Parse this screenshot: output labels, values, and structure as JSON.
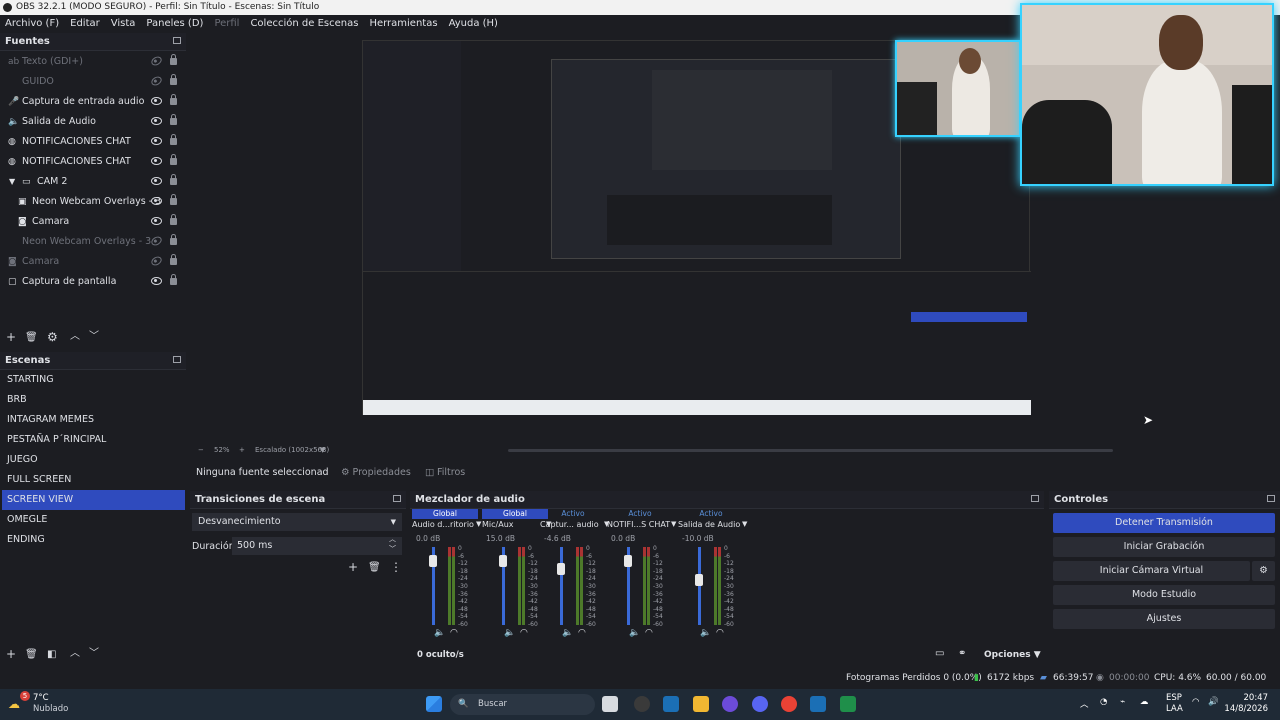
{
  "window": {
    "title": "OBS 32.2.1 (MODO SEGURO) - Perfil: Sin Título - Escenas: Sin Título"
  },
  "menu": [
    "Archivo (F)",
    "Editar",
    "Vista",
    "Paneles (D)",
    "Perfil",
    "Colección de Escenas",
    "Herramientas",
    "Ayuda (H)"
  ],
  "sources": {
    "title": "Fuentes",
    "items": [
      {
        "label": "Texto (GDI+)",
        "icon": "text-icon",
        "visible": false
      },
      {
        "label": "GUIDO",
        "icon": "",
        "visible": false
      },
      {
        "label": "Captura de entrada audio",
        "icon": "microphone-icon",
        "visible": true
      },
      {
        "label": "Salida de Audio",
        "icon": "speaker-icon",
        "visible": true
      },
      {
        "label": "NOTIFICACIONES CHAT",
        "icon": "globe-icon",
        "visible": true
      },
      {
        "label": "NOTIFICACIONES CHAT",
        "icon": "globe-icon",
        "visible": true
      },
      {
        "label": "CAM 2",
        "icon": "folder-icon",
        "visible": true
      },
      {
        "label": "Neon Webcam Overlays - 3",
        "icon": "image-icon",
        "visible": true
      },
      {
        "label": "Camara",
        "icon": "camera-icon",
        "visible": true
      },
      {
        "label": "Neon Webcam Overlays - 3",
        "icon": "",
        "visible": false
      },
      {
        "label": "Camara",
        "icon": "camera-icon",
        "visible": false
      },
      {
        "label": "Captura de pantalla",
        "icon": "monitor-icon",
        "visible": true
      }
    ]
  },
  "scenes": {
    "title": "Escenas",
    "items": [
      "STARTING",
      "BRB",
      "INTAGRAM MEMES",
      "PESTAÑA P´RINCIPAL",
      "JUEGO",
      "FULL SCREEN",
      "SCREEN VIEW",
      "OMEGLE",
      "ENDING"
    ],
    "selected": "SCREEN VIEW"
  },
  "preview": {
    "zoom": "52%",
    "scale_label": "Escalado (1002x563)"
  },
  "propbar": {
    "no_source": "Ninguna fuente seleccionad",
    "properties": "Propiedades",
    "filters": "Filtros"
  },
  "transitions": {
    "title": "Transiciones de escena",
    "transition": "Desvanecimiento",
    "duration_label": "Duración",
    "duration": "500 ms"
  },
  "mixer": {
    "title": "Mezclador de audio",
    "hidden": "0 oculto/s",
    "options": "Opciones",
    "channels": [
      {
        "tag": "Global",
        "name": "Audio d...ritorio",
        "db": "0.0 dB",
        "level": 0.82
      },
      {
        "tag": "Global",
        "name": "Mic/Aux",
        "db": "15.0 dB",
        "level": 0.82
      },
      {
        "tag": "Activo",
        "name": "Captur... audio",
        "db": "-4.6 dB",
        "level": 0.72
      },
      {
        "tag": "Activo",
        "name": "NOTIFI...S CHAT",
        "db": "0.0 dB",
        "level": 0.82
      },
      {
        "tag": "Activo",
        "name": "Salida de Audio",
        "db": "-10.0 dB",
        "level": 0.58
      }
    ],
    "scale": [
      "0",
      "-6",
      "-12",
      "-18",
      "-24",
      "-30",
      "-36",
      "-42",
      "-48",
      "-54",
      "-60"
    ]
  },
  "controls": {
    "title": "Controles",
    "buttons": [
      "Detener Transmisión",
      "Iniciar Grabación",
      "Iniciar Cámara Virtual",
      "Modo Estudio",
      "Ajustes"
    ]
  },
  "status": {
    "dropped": "Fotogramas Perdidos 0 (0.0%)",
    "bitrate": "6172 kbps",
    "stream_time": "66:39:57",
    "rec_time": "00:00:00",
    "cpu": "CPU: 4.6%",
    "fps": "60.00 / 60.00 FPS"
  },
  "taskbar": {
    "weather_temp": "7°C",
    "weather_text": "Nublado",
    "search": "Buscar",
    "lang": "ESP",
    "lang2": "LAA",
    "time": "20:47",
    "date": "14/8/2026",
    "badge": "5"
  },
  "colors": {
    "accent": "#2f4bbe",
    "neon": "#36d2ff",
    "bg": "#1c1d22"
  }
}
